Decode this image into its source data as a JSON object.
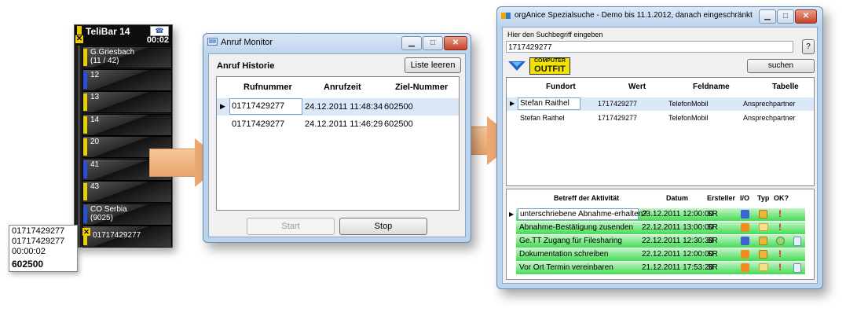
{
  "telibar": {
    "title": "TeliBar 14",
    "time": "00:02",
    "close_glyph": "✕",
    "icon": "phone-icon",
    "rows": [
      {
        "label": "G.Griesbach",
        "sub": "(11 / 42)",
        "color": "#e5d200"
      },
      {
        "label": "12",
        "sub": "",
        "color": "#2550d8"
      },
      {
        "label": "13",
        "sub": "",
        "color": "#e5d200"
      },
      {
        "label": "14",
        "sub": "",
        "color": "#e5d200"
      },
      {
        "label": "20",
        "sub": "",
        "color": "#e5d200"
      },
      {
        "label": "41",
        "sub": "",
        "color": "#2550d8"
      },
      {
        "label": "43",
        "sub": "",
        "color": "#e5d200"
      },
      {
        "label": "CO Serbia",
        "sub": "(9025)",
        "color": "#2550d8"
      },
      {
        "label": "01717429277",
        "sub": "",
        "color": "#e5d200"
      }
    ]
  },
  "popup": {
    "line1": "01717429277",
    "line2": "01717429277",
    "line3": "00:00:02",
    "line4": "602500"
  },
  "anruf_monitor": {
    "title": "Anruf Monitor",
    "section_label": "Anruf Historie",
    "clear_button": "Liste leeren",
    "columns": [
      "Rufnummer",
      "Anrufzeit",
      "Ziel-Nummer"
    ],
    "rows": [
      {
        "rufnummer": "01717429277",
        "anrufzeit": "24.12.2011 11:48:34",
        "ziel": "602500",
        "selected": true
      },
      {
        "rufnummer": "01717429277",
        "anrufzeit": "24.12.2011 11:46:29",
        "ziel": "602500",
        "selected": false
      }
    ],
    "start_button": "Start",
    "stop_button": "Stop"
  },
  "spezialsuche": {
    "title": "orgAnice Spezialsuche - Demo bis 11.1.2012, danach eingeschränkt",
    "prompt": "Hier den Suchbegriff eingeben",
    "search_value": "1717429277",
    "help_button": "?",
    "logo_line1": "COMPUTER",
    "logo_line2": "OUTFIT",
    "search_button": "suchen",
    "results_columns": [
      "Fundort",
      "Wert",
      "Feldname",
      "Tabelle"
    ],
    "results": [
      {
        "fundort": "Stefan Raithel",
        "wert": "1717429277",
        "feldname": "TelefonMobil",
        "tabelle": "Ansprechpartner"
      },
      {
        "fundort": "Stefan Raithel",
        "wert": "1717429277",
        "feldname": "TelefonMobil",
        "tabelle": "Ansprechpartner"
      }
    ],
    "activity_columns": [
      "Betreff der Aktivität",
      "Datum",
      "Ersteller",
      "I/O",
      "Typ",
      "OK?"
    ],
    "activities": [
      {
        "betreff": "unterschriebene Abnahme-erhalten?",
        "datum": "23.12.2011 12:00:00",
        "ersteller": "SR",
        "io": "blue",
        "typ": "book",
        "ok": "red",
        "extra": ""
      },
      {
        "betreff": "Abnahme-Bestätigung zusenden",
        "datum": "22.12.2011 13:00:00",
        "ersteller": "SR",
        "io": "orange",
        "typ": "env",
        "ok": "red",
        "extra": ""
      },
      {
        "betreff": "Ge.TT Zugang für Filesharing",
        "datum": "22.12.2011 12:30:38",
        "ersteller": "SR",
        "io": "blue",
        "typ": "book",
        "ok": "check",
        "extra": "doc"
      },
      {
        "betreff": "Dokumentation schreiben",
        "datum": "22.12.2011 12:00:00",
        "ersteller": "SR",
        "io": "orange",
        "typ": "book",
        "ok": "red",
        "extra": ""
      },
      {
        "betreff": "Vor Ort Termin vereinbaren",
        "datum": "21.12.2011 17:53:28",
        "ersteller": "SR",
        "io": "orange",
        "typ": "env",
        "ok": "red",
        "extra": "doc"
      }
    ]
  }
}
